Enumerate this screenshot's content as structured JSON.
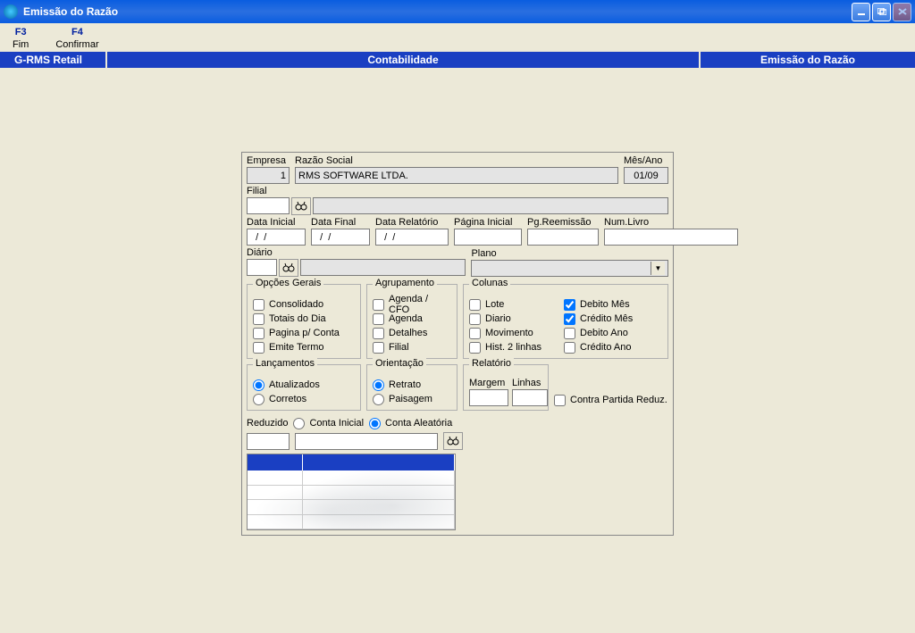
{
  "window_title": "Emissão do Razão",
  "menu": [
    {
      "key": "F3",
      "label": "Fim"
    },
    {
      "key": "F4",
      "label": "Confirmar"
    }
  ],
  "bluebar": {
    "left": "G-RMS Retail",
    "mid": "Contabilidade",
    "right": "Emissão do Razão"
  },
  "form": {
    "empresa_label": "Empresa",
    "empresa_val": "1",
    "razao_label": "Razão Social",
    "razao_val": "RMS SOFTWARE LTDA.",
    "mesano_label": "Mês/Ano",
    "mesano_val": "01/09",
    "filial_label": "Filial",
    "filial_val": "",
    "filial_desc": "",
    "data_ini_label": "Data Inicial",
    "data_ini_val": "  /  /",
    "data_fim_label": "Data Final",
    "data_fim_val": "  /  /",
    "data_rel_label": "Data Relatório",
    "data_rel_val": "  /  /",
    "pag_ini_label": "Página Inicial",
    "pag_ini_val": "",
    "reemi_label": "Pg.Reemissão",
    "reemi_val": "",
    "numlivro_label": "Num.Livro",
    "numlivro_val": "",
    "diario_label": "Diário",
    "diario_val": "",
    "diario_desc": "",
    "plano_label": "Plano",
    "plano_val": "",
    "reduzido_label": "Reduzido",
    "reduzido_val": ""
  },
  "opts": {
    "title": "Opções Gerais",
    "items": [
      "Consolidado",
      "Totais do Dia",
      "Pagina p/ Conta",
      "Emite Termo"
    ]
  },
  "agrup": {
    "title": "Agrupamento",
    "items": [
      "Agenda / CFO",
      "Agenda",
      "Detalhes",
      "Filial"
    ]
  },
  "colunas": {
    "title": "Colunas",
    "left": [
      "Lote",
      "Diario",
      "Movimento",
      "Hist. 2 linhas"
    ],
    "right": [
      {
        "l": "Debito Mês",
        "c": true
      },
      {
        "l": "Crédito Mês",
        "c": true
      },
      {
        "l": "Debito Ano",
        "c": false
      },
      {
        "l": "Crédito Ano",
        "c": false
      }
    ]
  },
  "lanc": {
    "title": "Lançamentos",
    "items": [
      "Atualizados",
      "Corretos"
    ],
    "selected": 0
  },
  "orient": {
    "title": "Orientação",
    "items": [
      "Retrato",
      "Paisagem"
    ],
    "selected": 0
  },
  "relat": {
    "title": "Relatório",
    "margem": "Margem",
    "linhas": "Linhas"
  },
  "contra": "Contra Partida Reduz.",
  "conta_radio": {
    "items": [
      "Conta Inicial",
      "Conta Aleatória"
    ],
    "selected": 1
  }
}
